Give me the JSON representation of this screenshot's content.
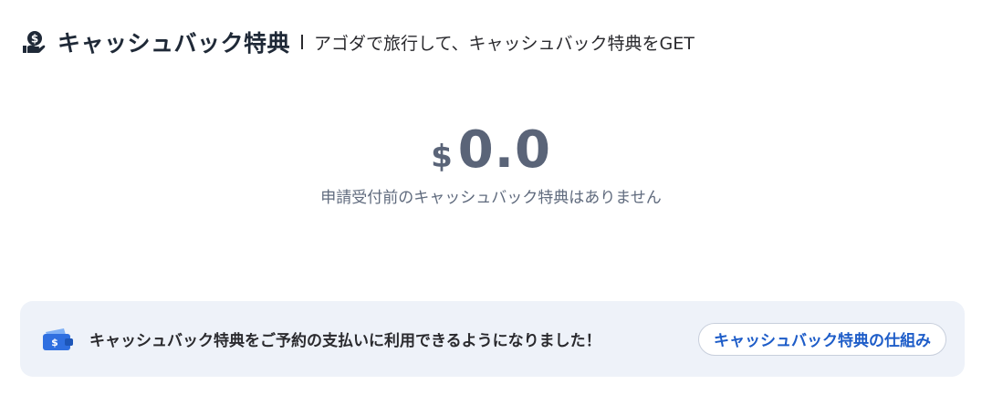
{
  "header": {
    "icon": "hand-dollar-coin-icon",
    "title": "キャッシュバック特典",
    "subtitle": "アゴダで旅行して、キャッシュバック特典をGET"
  },
  "balance": {
    "currency": "$",
    "amount": "0.0",
    "caption": "申請受付前のキャッシュバック特典はありません"
  },
  "banner": {
    "icon": "wallet-dollar-icon",
    "message": "キャッシュバック特典をご予約の支払いに利用できるようになりました！",
    "button_label": "キャッシュバック特典の仕組み"
  },
  "colors": {
    "amount": "#5a6478",
    "banner_bg": "#eef2f9",
    "link_blue": "#1d5cc8",
    "icon_blue": "#2f6fe0"
  }
}
